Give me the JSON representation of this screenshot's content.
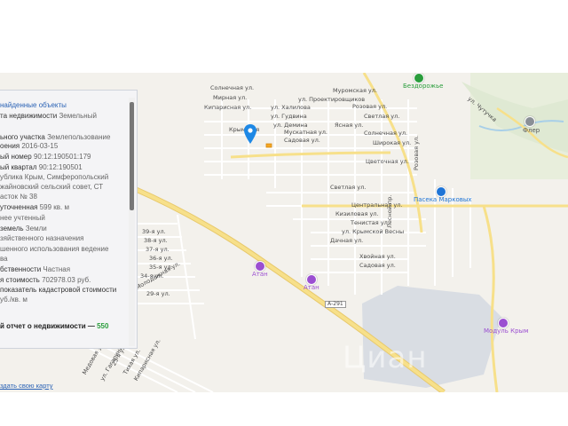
{
  "panel": {
    "title": "найденные объекты",
    "rows": [
      {
        "k": "та недвижимости",
        "v": "Земельный"
      },
      {
        "k": "ьного участка",
        "v": "Землепользование"
      },
      {
        "k": "оения",
        "v": "2016-03-15"
      },
      {
        "k": "ый номер",
        "v": "90:12:190501:179"
      },
      {
        "k": "ый квартал",
        "v": "90:12:190501"
      },
      {
        "k": "",
        "v": "ублика Крым, Симферопольский"
      },
      {
        "k": "",
        "v": "жайновский сельский совет, СТ"
      },
      {
        "k": "",
        "v": "асток № 38"
      },
      {
        "k": "уточненная",
        "v": "599 кв. м"
      },
      {
        "k": "",
        "v": "нее учтенный"
      },
      {
        "k": "земель",
        "v": "Земли"
      },
      {
        "k": "",
        "v": "зяйственного назначения"
      },
      {
        "k": "",
        "v": "шенного использования ведение"
      },
      {
        "k": "",
        "v": "ва"
      },
      {
        "k": "бственности",
        "v": "Частная"
      },
      {
        "k": "я стоимость",
        "v": "702978.03 руб."
      },
      {
        "k": "показатель кадастровой стоимости",
        "v": ""
      },
      {
        "k": "",
        "v": "уб./кв. м"
      }
    ],
    "report_label": "й отчет о недвижимости —",
    "report_price": "550",
    "bottom_link": "здать свою карту"
  },
  "map": {
    "streets": [
      "Солнечная ул.",
      "Мирная ул.",
      "Кипарисная ул.",
      "Крымская",
      "ул. Халилова",
      "ул. Гудвина",
      "ул. Демина",
      "Мускатная ул.",
      "Садовая ул.",
      "Муромская ул.",
      "ул. Проектировщиков",
      "Розовая ул.",
      "Светлая ул.",
      "Ясная ул.",
      "Солнечная ул.",
      "Широкая ул.",
      "Цветочная ул.",
      "Светлая ул.",
      "Центральная ул.",
      "Кизиловая ул.",
      "Тенистая ул.",
      "ул. Крымской Весны",
      "Дачная ул.",
      "Хвойная ул.",
      "Садовая ул.",
      "Розовая ул.",
      "Лесной пр.",
      "39-я ул.",
      "38-я ул.",
      "37-я ул.",
      "36-я ул.",
      "35-я ул.",
      "34-я ул.",
      "29-я ул.",
      "Молодёжная ул.",
      "Медовая ул.",
      "ул. Гагарина",
      "25-я ул.",
      "Тихая ул.",
      "Кипарисная ул.",
      "ул. Чутучка"
    ],
    "pois": [
      {
        "name": "Бездорожье",
        "color": "#2a9d3c"
      },
      {
        "name": "Пасека Марковых",
        "color": "#1e74d6"
      },
      {
        "name": "Флер",
        "color": "#8a8f96"
      },
      {
        "name": "Атан",
        "color": "#9b4fd1"
      },
      {
        "name": "Атан",
        "color": "#9b4fd1"
      },
      {
        "name": "Модуль Крым",
        "color": "#9b4fd1"
      }
    ],
    "highway": "А-291",
    "watermark": "Циан"
  },
  "colors": {
    "map_bg": "#f3f1ec",
    "road": "#ffffff",
    "main_road": "#f7e08a",
    "marker": "#1e88e5",
    "water": "#a8cfe8",
    "green": "#d6e8cc"
  }
}
